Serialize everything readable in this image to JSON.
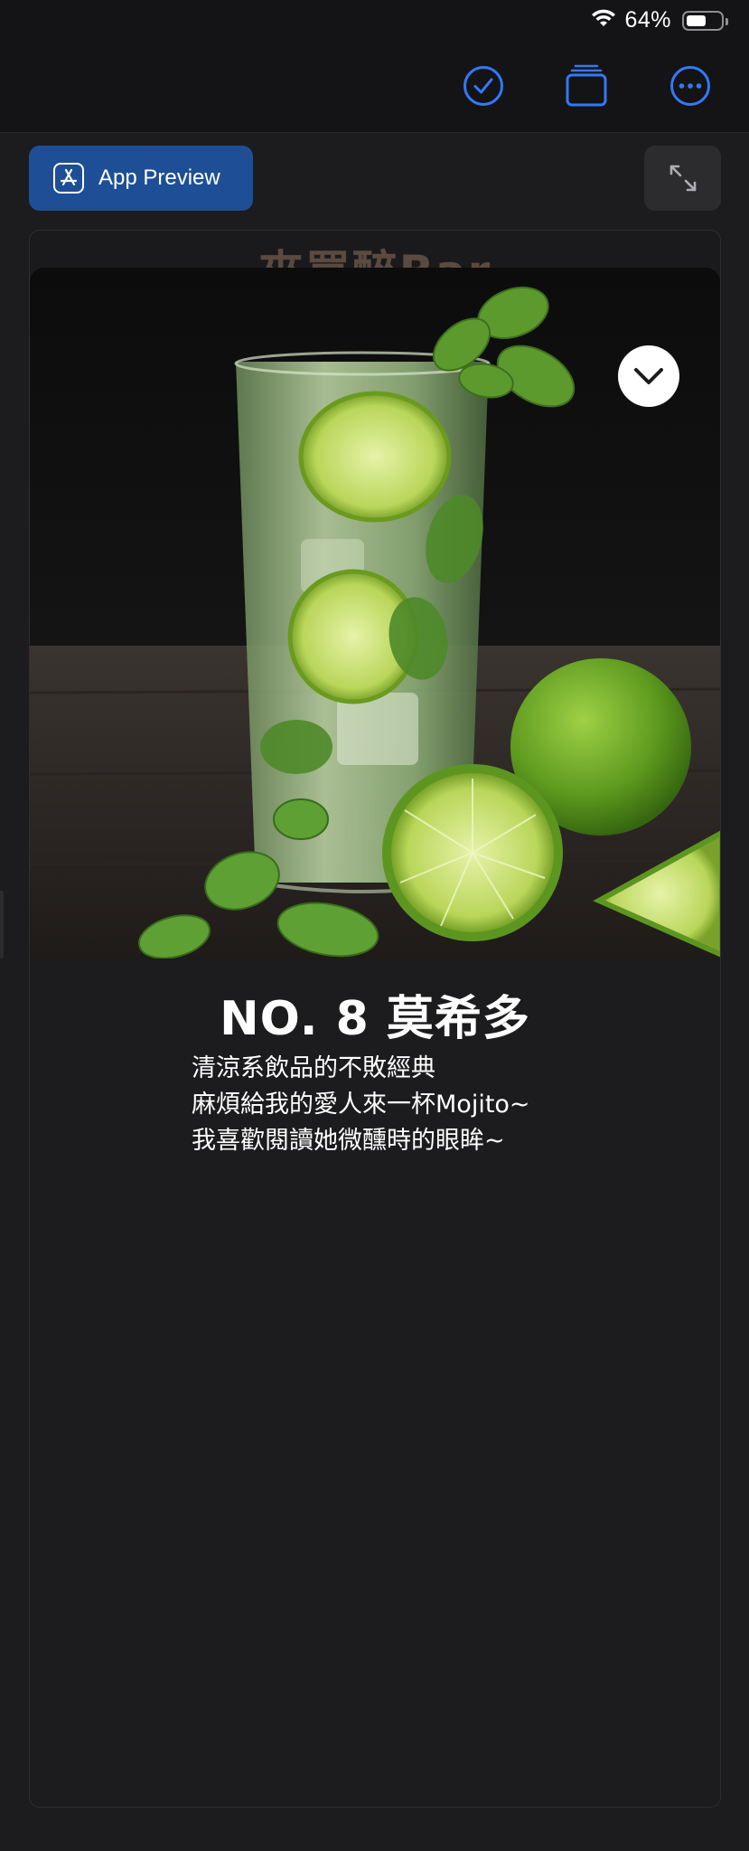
{
  "status_bar": {
    "battery_text": "64%",
    "battery_level": 0.64,
    "icons": [
      "wifi-icon",
      "battery-icon"
    ]
  },
  "toolbar": {
    "icons": [
      "checkmark-circle-icon",
      "stacked-windows-icon",
      "more-options-icon"
    ],
    "accent_color": "#3478f6"
  },
  "app_preview": {
    "label": "App Preview",
    "icon": "app-store-icon",
    "background": "#1e4f96"
  },
  "expand": {
    "icon": "expand-arrows-icon"
  },
  "page": {
    "header_title": "來買醉Bar"
  },
  "drink": {
    "photo": "mojito-glass-with-limes-and-mint",
    "title": "NO. 8 莫希多",
    "description_lines": [
      "清涼系飲品的不敗經典",
      "麻煩給我的愛人來一杯Mojito~",
      "我喜歡閱讀她微醺時的眼眸~"
    ],
    "collapse_icon": "chevron-down-icon"
  }
}
